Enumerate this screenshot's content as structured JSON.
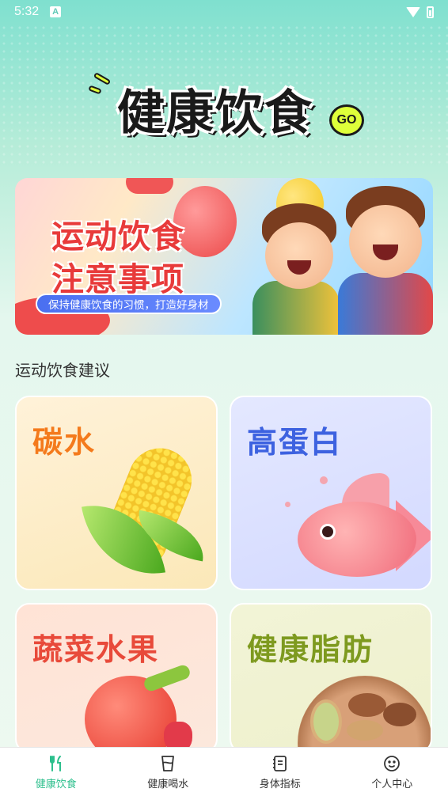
{
  "status_bar": {
    "time": "5:32",
    "notification": "A"
  },
  "logo": {
    "title": "健康饮食",
    "badge": "GO"
  },
  "banner": {
    "title_line1": "运动饮食",
    "title_line2": "注意事项",
    "subtitle": "保持健康饮食的习惯，打造好身材"
  },
  "section": {
    "title": "运动饮食建议"
  },
  "cards": [
    {
      "label": "碳水",
      "icon": "corn-icon"
    },
    {
      "label": "高蛋白",
      "icon": "fish-icon"
    },
    {
      "label": "蔬菜水果",
      "icon": "tomato-icon"
    },
    {
      "label": "健康脂肪",
      "icon": "nuts-icon"
    }
  ],
  "tabbar": {
    "active": 0,
    "items": [
      {
        "label": "健康饮食",
        "icon": "fork-knife-icon"
      },
      {
        "label": "健康喝水",
        "icon": "cup-icon"
      },
      {
        "label": "身体指标",
        "icon": "notebook-icon"
      },
      {
        "label": "个人中心",
        "icon": "smiley-icon"
      }
    ]
  },
  "colors": {
    "accent": "#2cbf8c",
    "banner_title": "#e83a3a"
  }
}
